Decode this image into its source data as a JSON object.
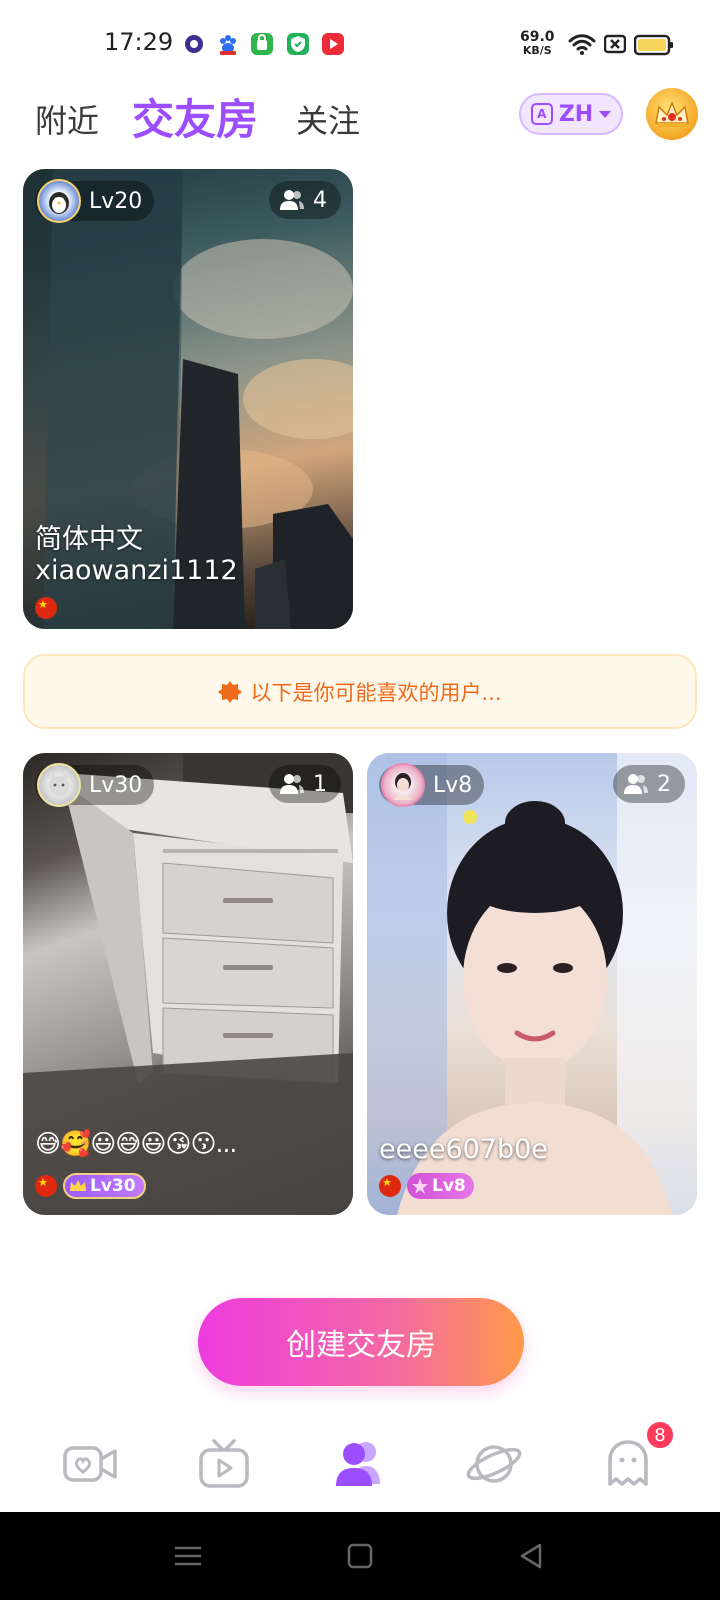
{
  "status_bar": {
    "time": "17:29",
    "net_speed_value": "69.0",
    "net_speed_unit": "KB/S"
  },
  "header": {
    "tabs": [
      {
        "label": "附近",
        "active": false
      },
      {
        "label": "交友房",
        "active": true
      },
      {
        "label": "关注",
        "active": false
      }
    ],
    "language_label": "ZH",
    "language_icon_letter": "A"
  },
  "rooms_top": [
    {
      "level": "Lv20",
      "user_count": "4",
      "title": "简体中文",
      "owner": "xiaowanzi1112"
    }
  ],
  "recommend_banner": {
    "text": "以下是你可能喜欢的用户..."
  },
  "rooms_recommended": [
    {
      "level": "Lv30",
      "user_count": "1",
      "title": "😅🥰😃😅😃😘😗...",
      "badge_level": "Lv30"
    },
    {
      "level": "Lv8",
      "user_count": "2",
      "title": "eeee607b0e",
      "badge_level": "Lv8"
    }
  ],
  "create_button": {
    "label": "创建交友房"
  },
  "bottom_nav": {
    "items": [
      {
        "icon": "video-call-icon",
        "active": false
      },
      {
        "icon": "tv-icon",
        "active": false
      },
      {
        "icon": "friends-room-icon",
        "active": true
      },
      {
        "icon": "planet-icon",
        "active": false
      },
      {
        "icon": "ghost-chat-icon",
        "active": false
      }
    ],
    "message_badge": "8"
  },
  "colors": {
    "accent": "#9b4dff",
    "gradient_start": "#ee3be0",
    "gradient_end": "#ff9a4a",
    "banner_text": "#ef6a1a"
  }
}
